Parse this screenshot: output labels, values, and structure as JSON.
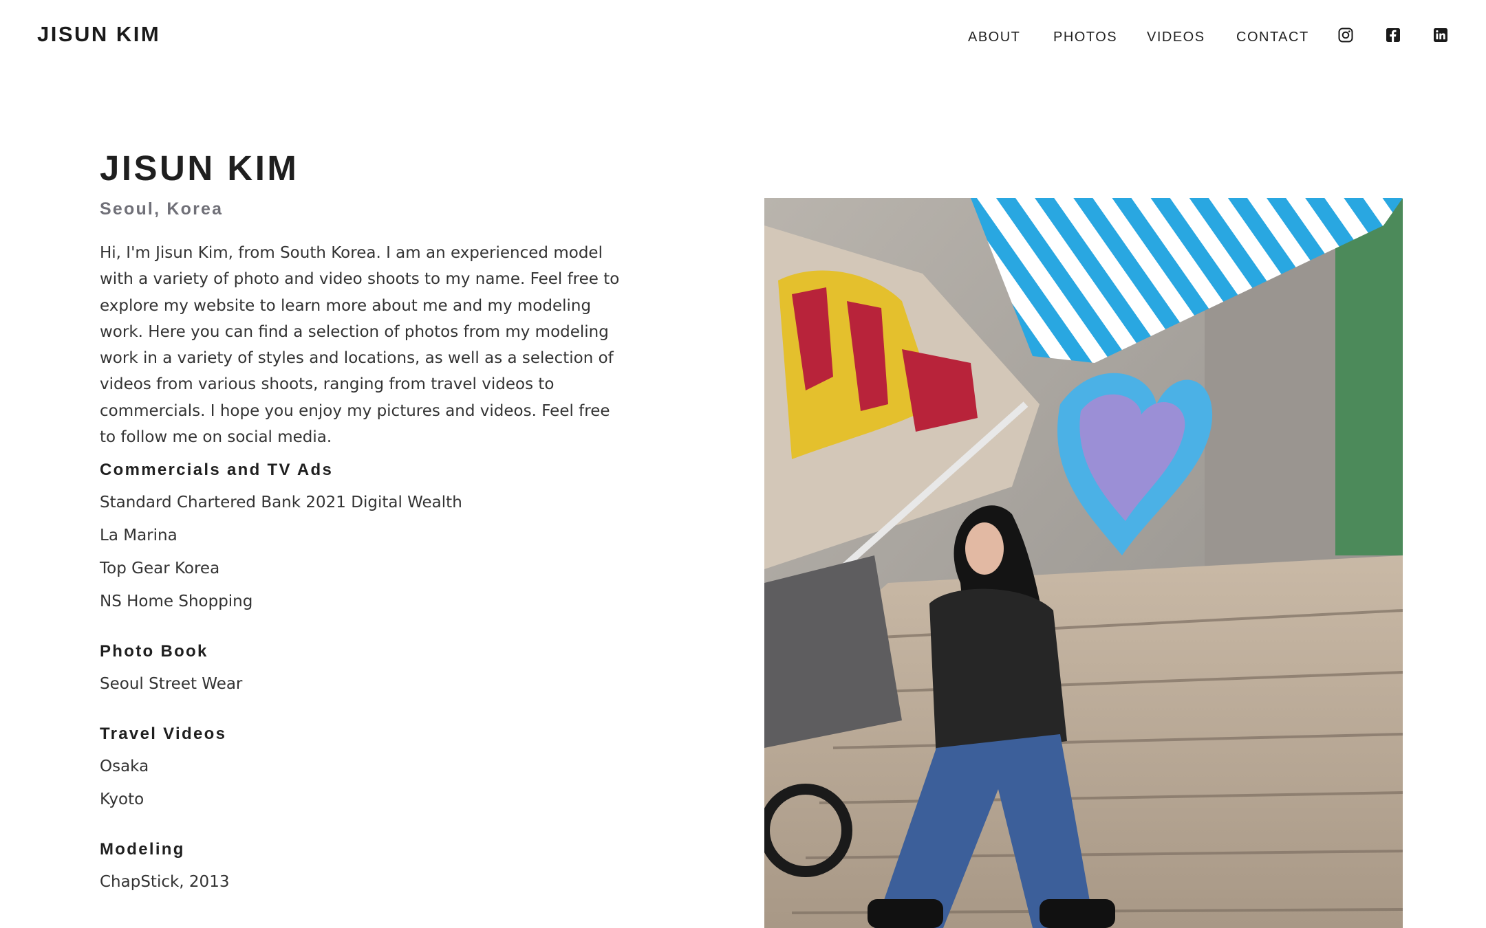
{
  "header": {
    "brand": "JISUN KIM",
    "nav": [
      "ABOUT",
      "PHOTOS",
      "VIDEOS",
      "CONTACT"
    ],
    "social_icons": [
      "instagram-icon",
      "facebook-icon",
      "linkedin-icon"
    ]
  },
  "main": {
    "title": "JISUN KIM",
    "location": "Seoul, Korea",
    "intro": "Hi, I'm Jisun Kim, from South Korea. I am an experienced model with a variety of photo and video shoots to my name. Feel free to explore my website to learn more about me and my modeling work. Here you can find a selection of photos from my modeling work in a variety of styles and locations, as well as a selection of videos from various shoots, ranging from travel videos to commercials. I hope you enjoy my pictures and videos. Feel free to follow me on social media.",
    "sections": [
      {
        "heading": "Commercials and TV Ads",
        "items": [
          "Standard Chartered Bank 2021 Digital Wealth",
          "La Marina",
          "Top Gear Korea",
          "NS Home Shopping"
        ]
      },
      {
        "heading": "Photo Book",
        "items": [
          "Seoul Street Wear"
        ]
      },
      {
        "heading": "Travel Videos",
        "items": [
          "Osaka",
          "Kyoto"
        ]
      },
      {
        "heading": "Modeling",
        "items": [
          "ChapStick, 2013"
        ]
      }
    ]
  },
  "colors": {
    "text": "#1f1f1f",
    "muted": "#707078",
    "background": "#ffffff"
  }
}
